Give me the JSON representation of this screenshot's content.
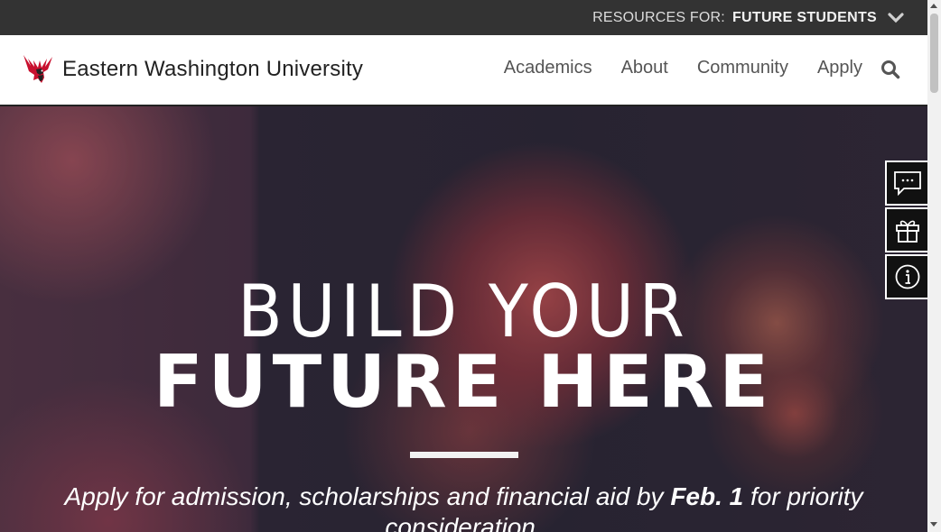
{
  "resources_bar": {
    "label": "RESOURCES FOR:",
    "selected": "FUTURE STUDENTS",
    "chevron_icon": "chevron-down-icon"
  },
  "header": {
    "logo_icon": "eagle-logo-icon",
    "brand": "Eastern Washington University",
    "nav": [
      "Academics",
      "About",
      "Community",
      "Apply"
    ],
    "search_icon": "search-icon"
  },
  "hero": {
    "title_line1": "BUILD YOUR",
    "title_line2": "FUTURE HERE",
    "subtitle_pre": "Apply for admission, scholarships and financial aid by ",
    "subtitle_date": "Feb. 1",
    "subtitle_post": " for priority consideration."
  },
  "side_tools": [
    "chat-icon",
    "gift-icon",
    "info-icon"
  ],
  "colors": {
    "topbar": "#333333",
    "brand_text": "#222222",
    "nav_text": "#555555",
    "eagle_red": "#c8102e"
  }
}
